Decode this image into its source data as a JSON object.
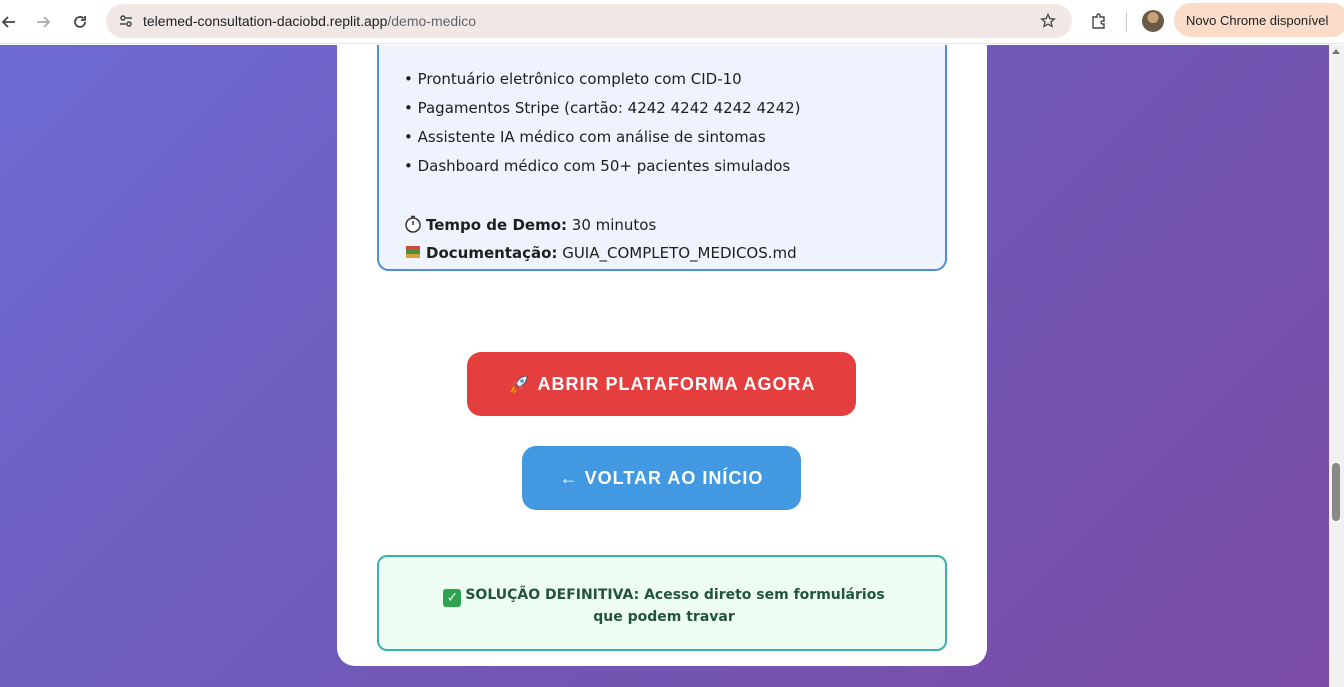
{
  "browser": {
    "url_host": "telemed-consultation-daciobd.replit.app",
    "url_path": "/demo-medico",
    "update_label": "Novo Chrome disponível"
  },
  "info": {
    "features": [
      "• Prontuário eletrônico completo com CID-10",
      "• Pagamentos Stripe (cartão: 4242 4242 4242 4242)",
      "• Assistente IA médico com análise de sintomas",
      "• Dashboard médico com 50+ pacientes simulados"
    ],
    "demo_time_label": "Tempo de Demo:",
    "demo_time_value": "30 minutos",
    "docs_label": "Documentação:",
    "docs_value": "GUIA_COMPLETO_MEDICOS.md"
  },
  "actions": {
    "open_label": "ABRIR PLATAFORMA AGORA",
    "back_label": "← VOLTAR AO INÍCIO"
  },
  "notice": {
    "text": "SOLUÇÃO DEFINITIVA: Acesso direto sem formulários que podem travar"
  },
  "colors": {
    "primary_red": "#e53e3e",
    "primary_blue": "#4299e1",
    "info_border": "#4a90d9",
    "success_border": "#38b2ac"
  }
}
